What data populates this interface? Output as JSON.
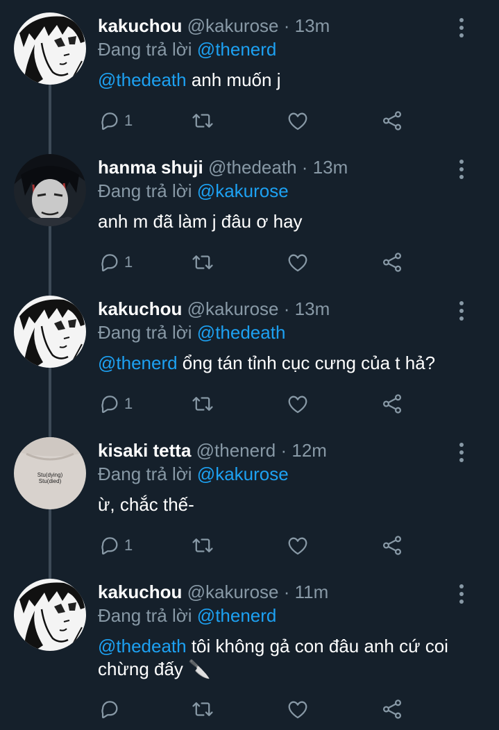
{
  "colors": {
    "background": "#15202b",
    "accent": "#1da1f2",
    "secondary_text": "#8899a6",
    "thread_line": "#3d4a57"
  },
  "tweets": [
    {
      "name": "kakuchou",
      "handle": "@kakurose",
      "separator": "·",
      "time": "13m",
      "reply_prefix": "Đang trả lời",
      "reply_to": "@thenerd",
      "mention": "@thedeath",
      "text": " anh muốn j",
      "reply_count": "1",
      "avatar": "manga-boy-avatar"
    },
    {
      "name": "hanma shuji",
      "handle": "@thedeath",
      "separator": "·",
      "time": "13m",
      "reply_prefix": "Đang trả lời",
      "reply_to": "@kakurose",
      "mention": "",
      "text": "anh m đã làm j đâu ơ hay",
      "reply_count": "1",
      "avatar": "anime-man-avatar"
    },
    {
      "name": "kakuchou",
      "handle": "@kakurose",
      "separator": "·",
      "time": "13m",
      "reply_prefix": "Đang trả lời",
      "reply_to": "@thedeath",
      "mention": "@thenerd",
      "text": " ổng tán tỉnh cục cưng của t hả?",
      "reply_count": "1",
      "avatar": "manga-boy-avatar"
    },
    {
      "name": "kisaki tetta",
      "handle": "@thenerd",
      "separator": "·",
      "time": "12m",
      "reply_prefix": "Đang trả lời",
      "reply_to": "@kakurose",
      "mention": "",
      "text": "ừ, chắc thế-",
      "reply_count": "1",
      "avatar": "shirt-print-avatar",
      "avatar_text": [
        "Stu(dying)",
        "Stu(died)"
      ]
    },
    {
      "name": "kakuchou",
      "handle": "@kakurose",
      "separator": "·",
      "time": "11m",
      "reply_prefix": "Đang trả lời",
      "reply_to": "@thenerd",
      "mention": "@thedeath",
      "text": " tôi không gả con đâu anh cứ coi chừng đấy 🔪",
      "reply_count": "",
      "avatar": "manga-boy-avatar"
    }
  ]
}
